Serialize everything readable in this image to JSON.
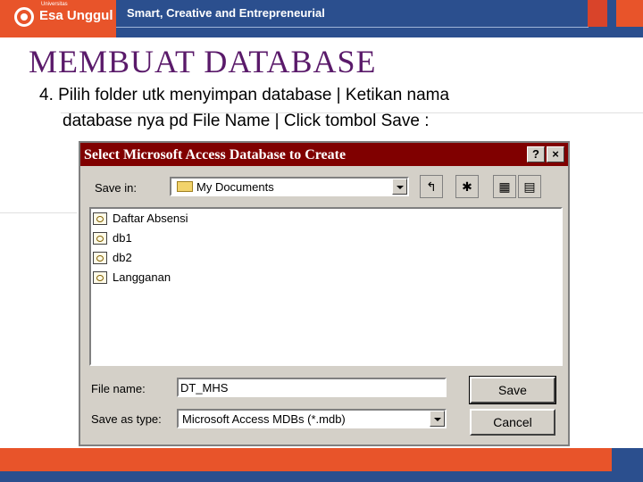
{
  "header": {
    "logo_small": "Universitas",
    "logo_text": "Esa Unggul",
    "tagline": "Smart, Creative and Entrepreneurial",
    "colors": {
      "brand_blue": "#2b4f8e",
      "brand_orange": "#e8542a",
      "title_purple": "#5a1a6a"
    }
  },
  "slide": {
    "title": "MEMBUAT  DATABASE",
    "line1": "4. Pilih folder utk menyimpan database  | Ketikan nama",
    "line2": "database nya pd File Name | Click tombol Save :"
  },
  "dialog": {
    "title": "Select Microsoft Access Database to Create",
    "help_label": "?",
    "close_label": "×",
    "save_in_label": "Save in:",
    "save_in_value": "My Documents",
    "toolbar": {
      "up_icon": "↰",
      "new_folder_icon": "✱",
      "list_icon": "▦",
      "details_icon": "▤"
    },
    "files": [
      "Daftar Absensi",
      "db1",
      "db2",
      "Langganan"
    ],
    "file_name_label": "File name:",
    "file_name_value": "DT_MHS",
    "save_as_type_label": "Save as type:",
    "save_as_type_value": "Microsoft Access MDBs (*.mdb)",
    "save_label": "Save",
    "cancel_label": "Cancel",
    "colors": {
      "titlebar": "#800000",
      "face": "#d4d0c8"
    }
  }
}
